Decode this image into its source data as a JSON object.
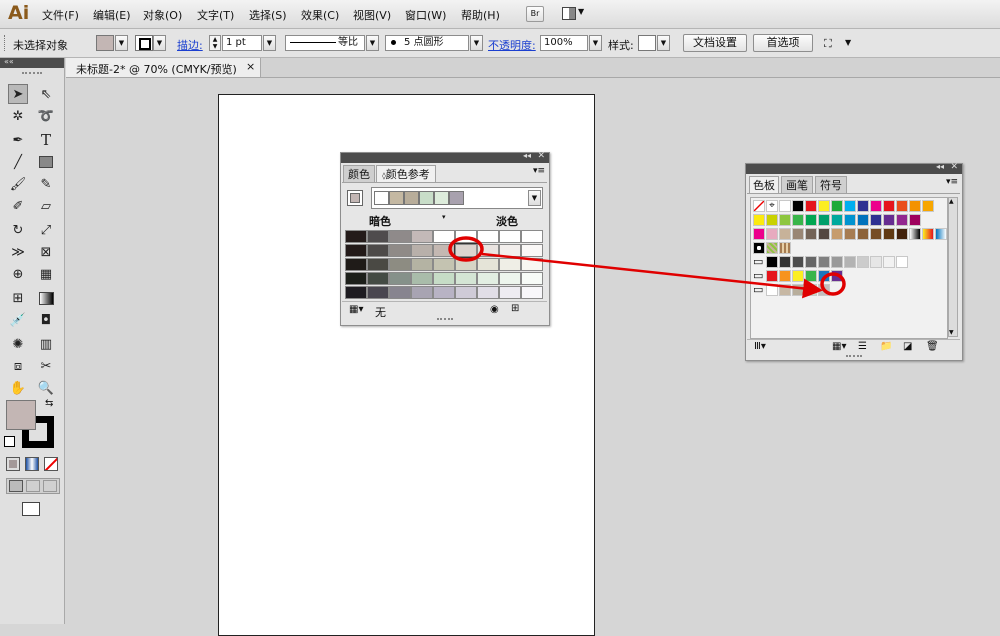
{
  "app": {
    "logo": "Ai"
  },
  "menu": [
    "文件(F)",
    "编辑(E)",
    "对象(O)",
    "文字(T)",
    "选择(S)",
    "效果(C)",
    "视图(V)",
    "窗口(W)",
    "帮助(H)"
  ],
  "menu_right": {
    "bridge_label": "Br"
  },
  "control_bar": {
    "selection_status": "未选择对象",
    "stroke_label": "描边:",
    "stroke_weight": "1 pt",
    "profile": "等比",
    "brush": "5 点圆形",
    "opacity_label": "不透明度:",
    "opacity_value": "100%",
    "style_label": "样式:",
    "doc_setup_button": "文档设置",
    "prefs_button": "首选项"
  },
  "document_tab": {
    "title": "未标题-2* @ 70% (CMYK/预览)",
    "close": "×"
  },
  "color_guide_panel": {
    "tabs": [
      "颜色",
      "颜色参考"
    ],
    "shades_label": "暗色",
    "tints_label": "淡色",
    "footer_none": "无",
    "harmony_colors": [
      "#ffffff",
      "#c4b8a2",
      "#b8ad9a",
      "#c8ddc8",
      "#ddecdb",
      "#a8a1ae"
    ],
    "grid_rows": [
      [
        "#241b1a",
        "#4f4c4d",
        "#8f8a8a",
        "#c3b9b8",
        "#ffffff",
        "#ffffff",
        "#ffffff",
        "#ffffff",
        "#ffffff"
      ],
      [
        "#231a19",
        "#4d4a49",
        "#8f8a87",
        "#b8b0aa",
        "#c4b8b2",
        "#dcd4d0",
        "#e9e3e0",
        "#f2eeec",
        "#faf8f7"
      ],
      [
        "#1f1b18",
        "#4a4944",
        "#8d8c82",
        "#b4b3a3",
        "#c4c3b1",
        "#d6d5c6",
        "#e5e4d8",
        "#efeee6",
        "#f8f7f2"
      ],
      [
        "#1c1f1a",
        "#444b44",
        "#85918a",
        "#a9bcaa",
        "#c6dcc6",
        "#d4e5d4",
        "#e2eee2",
        "#edf5ed",
        "#f7fbf7"
      ],
      [
        "#1e1c21",
        "#49464f",
        "#87848f",
        "#a8a4b2",
        "#b8b3c4",
        "#cfcbd7",
        "#e1dee7",
        "#eeecf2",
        "#f8f7fa"
      ]
    ]
  },
  "swatches_panel": {
    "tabs": [
      "色板",
      "画笔",
      "符号"
    ],
    "rows": [
      [
        "none",
        "registration",
        "#ffffff",
        "#000000",
        "#e5141b",
        "#fcee21",
        "#1eaa39",
        "#00aeef",
        "#2e3192",
        "#ec008c",
        "#e5141b",
        "#e94e1b",
        "#f39200",
        "#f7a600"
      ],
      [
        "#fcea10",
        "#c9d200",
        "#8dc63f",
        "#39b54a",
        "#00a651",
        "#009f6b",
        "#00a99d",
        "#0093d0",
        "#0072bc",
        "#2e3192",
        "#662d91",
        "#92278f",
        "#9e005d"
      ],
      [
        "#ec008c",
        "#e7aabf",
        "#c7b299",
        "#998675",
        "#736357",
        "#534741",
        "#c69c6d",
        "#a67c52",
        "#8c6239",
        "#754c24",
        "#603913",
        "#42210b",
        "grad1",
        "grad2",
        "grad3"
      ],
      [
        "pattern1",
        "pattern2",
        "pattern3"
      ],
      [
        "folder",
        "#000000",
        "#333333",
        "#4d4d4d",
        "#666666",
        "#808080",
        "#999999",
        "#b3b3b3",
        "#cccccc",
        "#e6e6e6",
        "#f2f2f2",
        "#ffffff"
      ],
      [
        "folder",
        "#e5141b",
        "#f7931e",
        "#fcee21",
        "#39b54a",
        "#1b75bc",
        "#662d91"
      ],
      [
        "folder",
        "#ffffff",
        "#c7b8a4",
        "#b8ae9c",
        "#c8ddc8",
        "#c4bcbc"
      ]
    ]
  },
  "fill_stroke": {
    "fill_color": "#c3b6b4",
    "stroke_color": "#000000"
  },
  "annotation": {
    "highlight_color": "#e00000"
  }
}
